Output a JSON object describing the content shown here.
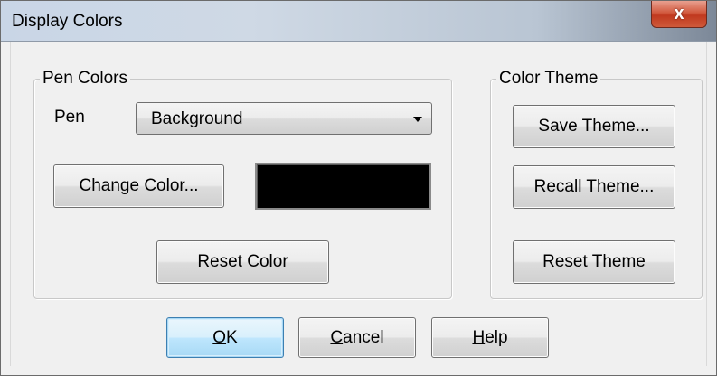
{
  "window": {
    "title": "Display Colors",
    "close_label": "x"
  },
  "pen_colors": {
    "group_label": "Pen Colors",
    "pen_label": "Pen",
    "pen_select_value": "Background",
    "change_color_button": "Change Color...",
    "current_color": "#000000",
    "reset_color_button": "Reset Color"
  },
  "color_theme": {
    "group_label": "Color Theme",
    "save_theme_button": "Save Theme...",
    "recall_theme_button": "Recall Theme...",
    "reset_theme_button": "Reset Theme"
  },
  "footer": {
    "ok_accel": "O",
    "ok_rest": "K",
    "cancel_accel": "C",
    "cancel_rest": "ancel",
    "help_accel": "H",
    "help_rest": "elp"
  }
}
